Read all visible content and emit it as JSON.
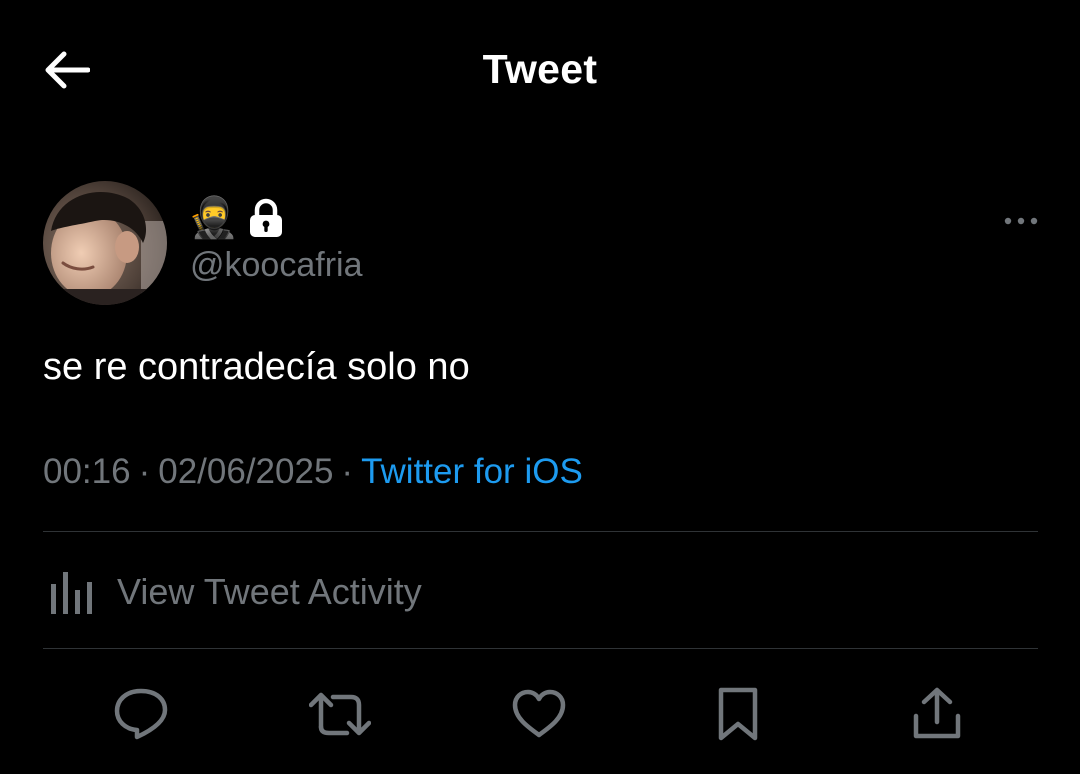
{
  "header": {
    "title": "Tweet",
    "back_icon": "arrow-left-icon"
  },
  "author": {
    "display_name_emoji": "🥷",
    "protected_icon": "lock-icon",
    "handle": "@koocafria",
    "avatar": "profile-photo"
  },
  "tweet": {
    "text": "se re contradecía solo no",
    "time": "00:16",
    "date": "02/06/2025",
    "separator": "·",
    "source": "Twitter for iOS"
  },
  "activity": {
    "label": "View Tweet Activity",
    "icon": "bar-chart-icon"
  },
  "actions": {
    "reply_icon": "reply-icon",
    "retweet_icon": "retweet-icon",
    "like_icon": "heart-icon",
    "bookmark_icon": "bookmark-icon",
    "share_icon": "share-icon"
  },
  "colors": {
    "background": "#000000",
    "text_primary": "#ffffff",
    "text_secondary": "#71767b",
    "link": "#1d9bf0",
    "divider": "#2f3336"
  }
}
